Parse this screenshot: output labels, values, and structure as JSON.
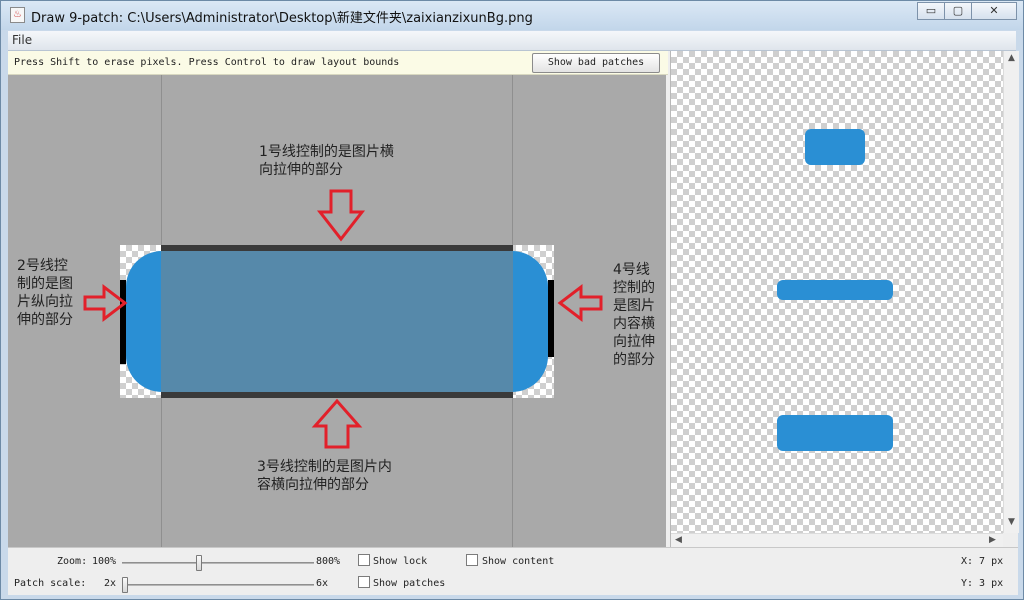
{
  "window": {
    "title": "Draw 9-patch: C:\\Users\\Administrator\\Desktop\\新建文件夹\\zaixianzixunBg.png",
    "app_icon_glyph": "♨",
    "controls": {
      "minimize": "▭",
      "maximize": "▢",
      "close": "✕"
    }
  },
  "menu": {
    "file": "File"
  },
  "hint_bar": {
    "text": "Press Shift to erase pixels. Press Control to draw layout bounds",
    "bad_patches_button": "Show bad patches"
  },
  "editor": {
    "annotations": {
      "line1": [
        "1号线控制的是图片横",
        "向拉伸的部分"
      ],
      "line2": [
        "2号线控",
        "制的是图",
        "片纵向拉",
        "伸的部分"
      ],
      "line3": [
        "3号线控制的是图片内",
        "容横向拉伸的部分"
      ],
      "line4": [
        "4号线",
        "控制的",
        "是图片",
        "内容横",
        "向拉伸",
        "的部分"
      ]
    },
    "arrow_color": "#e2202a"
  },
  "colors": {
    "accent": "#2a8fd4",
    "stretch_overlay": "#5689aa"
  },
  "bottom": {
    "zoom_label": "Zoom:",
    "zoom_min": "100%",
    "zoom_max": "800%",
    "zoom_level": 0.4,
    "patch_scale_label": "Patch scale:",
    "patch_min": "2x",
    "patch_max": "6x",
    "patch_level": 0.0,
    "show_lock": "Show lock",
    "show_content": "Show content",
    "show_patches": "Show patches",
    "x_readout": "X: 7 px",
    "y_readout": "Y: 3 px"
  }
}
